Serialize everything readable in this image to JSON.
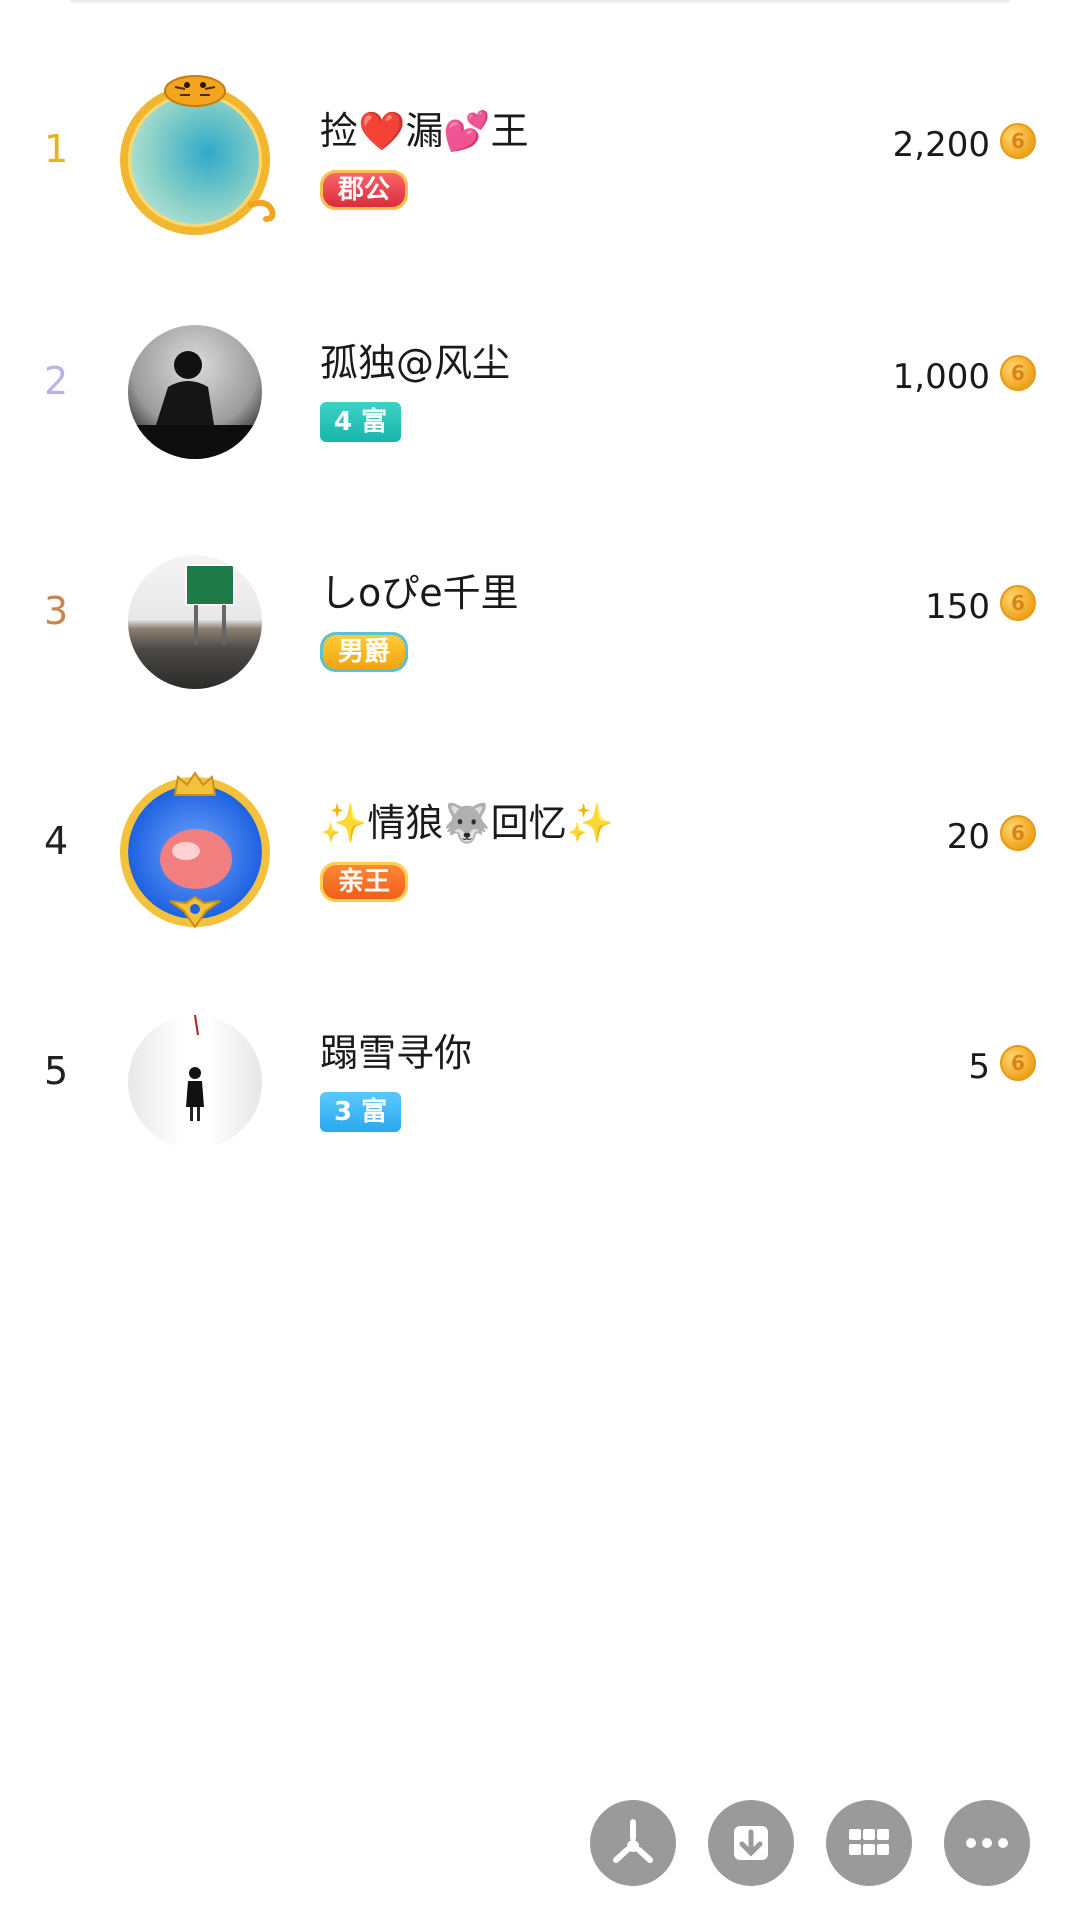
{
  "leaderboard": [
    {
      "rank": "1",
      "name": "捡❤️漏💕王",
      "badge": "郡公",
      "score": "2,200",
      "rank_color": "#e6b31b",
      "badge_bg": "linear-gradient(#ff6a6a,#d6263b)"
    },
    {
      "rank": "2",
      "name": "孤独@风尘",
      "badge": "4 富",
      "score": "1,000",
      "rank_color": "#b9b3e6",
      "badge_bg": "linear-gradient(#3fd2c6,#16b6aa)"
    },
    {
      "rank": "3",
      "name": "しoぴe千里",
      "badge": "男爵",
      "score": "150",
      "rank_color": "#c8864e",
      "badge_bg": "linear-gradient(#ffcf3a,#f2a10f)"
    },
    {
      "rank": "4",
      "name": "✨情狼🐺回忆✨",
      "badge": "亲王",
      "score": "20",
      "rank_color": "#222222",
      "badge_bg": "linear-gradient(#ff8b3c,#f05a14)"
    },
    {
      "rank": "5",
      "name": "蹋雪寻你",
      "badge": "3 富",
      "score": "5",
      "rank_color": "#222222",
      "badge_bg": "linear-gradient(#5bc9ff,#2aa8ee)"
    }
  ],
  "coin_symbol": "6",
  "fab": [
    {
      "name": "share-icon",
      "glyph": "⚬"
    },
    {
      "name": "download-icon",
      "glyph": "⤓"
    },
    {
      "name": "grid-icon",
      "glyph": "▦"
    },
    {
      "name": "more-icon",
      "glyph": "•••"
    }
  ]
}
